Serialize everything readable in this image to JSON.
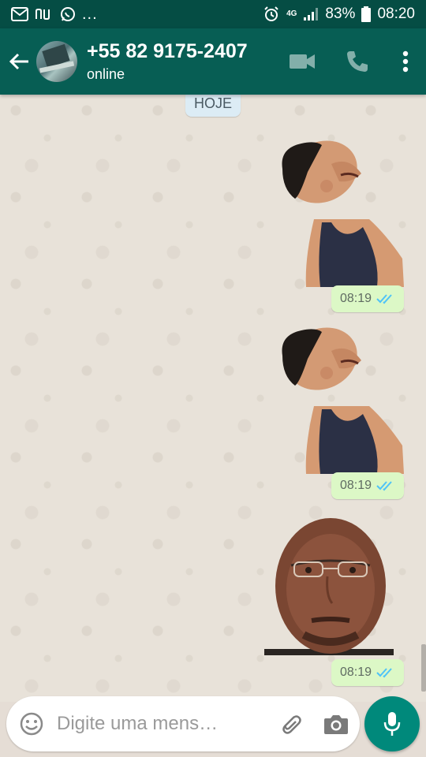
{
  "status_bar": {
    "left_icons": [
      "gmail-icon",
      "nubank-icon",
      "whatsapp-notification-icon"
    ],
    "more": "...",
    "network": "4G",
    "battery": "83%",
    "time": "08:20"
  },
  "header": {
    "contact_name": "+55 82 9175-2407",
    "contact_status": "online"
  },
  "chat": {
    "date_label": "HOJE",
    "messages": [
      {
        "type": "sticker",
        "subject": "man-laughing",
        "time": "08:19",
        "read": true
      },
      {
        "type": "sticker",
        "subject": "man-laughing",
        "time": "08:19",
        "read": true
      },
      {
        "type": "sticker",
        "subject": "man-face-glasses",
        "time": "08:19",
        "read": true
      }
    ]
  },
  "input": {
    "placeholder": "Digite uma mens…",
    "value": ""
  },
  "colors": {
    "status_bar": "#054d44",
    "header": "#075e54",
    "outgoing_bubble": "#dcf8c6",
    "read_ticks": "#4fc3f7",
    "mic_button": "#00897b",
    "chat_background": "#e8e2d9"
  }
}
